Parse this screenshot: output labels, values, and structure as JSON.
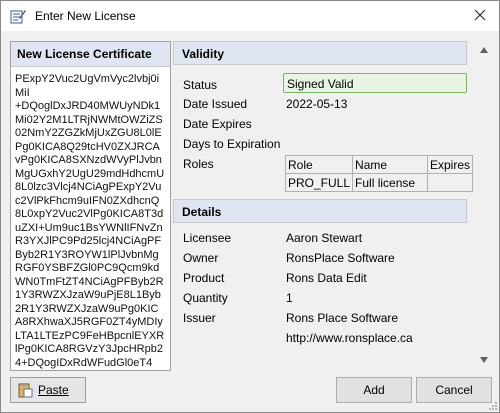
{
  "window": {
    "title": "Enter New License"
  },
  "certificate": {
    "header": "New License Certificate",
    "text": "PExpY2Vuc2UgVmVyc2lvbj0iMiI\n+DQoglDxJRD40MWUyNDk1Mi02Y2M1LTRjNWMtOWZiZS02NmY2ZGZkMjUxZGU8L0lEPg0KICA8Q29tcHV0ZXJRCAvPg0KICA8SXNzdWVyPlJvbnMgUGxhY2UgU29mdHdhcmU8L0lzc3Vlcj4NCiAgPExpY2Vuc2VlPkFhcm9uIFN0ZXdhcnQ8L0xpY2Vuc2VlPg0KICA8T3duZXI+Um9uc1BsYWNlIFNvZnR3YXJlPC9Pd25lcj4NCiAgPFByb2R1Y3ROYW1lPlJvbnMgRGF0YSBFZGl0PC9Qcm9kdWN0TmFtZT4NCiAgPFByb2R1Y3RWZXJzaW9uPjE8L1Byb2R1Y3RWZXJzaW9uPg0KICA8RXhwaXJ5RGF0ZT4yMDIyLTA1LTEzPC9FeHBpcnlEYXRlPg0KICA8RGVzY3JpcHRpb24+DQogIDxRdWFudGl0eT4"
  },
  "validity": {
    "header": "Validity",
    "status_label": "Status",
    "status_value": "Signed Valid",
    "date_issued_label": "Date Issued",
    "date_issued_value": "2022-05-13",
    "date_expires_label": "Date Expires",
    "days_label": "Days to Expiration",
    "roles_label": "Roles",
    "roles_columns": [
      "Role",
      "Name",
      "Expires"
    ],
    "roles_rows": [
      [
        "PRO_FULL",
        "Full license",
        ""
      ]
    ]
  },
  "details": {
    "header": "Details",
    "licensee_label": "Licensee",
    "licensee_value": "Aaron Stewart",
    "owner_label": "Owner",
    "owner_value": "RonsPlace Software",
    "product_label": "Product",
    "product_value": "Rons Data Edit",
    "quantity_label": "Quantity",
    "quantity_value": "1",
    "issuer_label": "Issuer",
    "issuer_value": "Rons Place Software",
    "issuer_url": "http://www.ronsplace.ca"
  },
  "buttons": {
    "paste": "Paste",
    "add": "Add",
    "cancel": "Cancel"
  },
  "icons": {
    "app": "license-edit-icon",
    "close": "close-icon",
    "paste": "clipboard-paste-icon"
  }
}
